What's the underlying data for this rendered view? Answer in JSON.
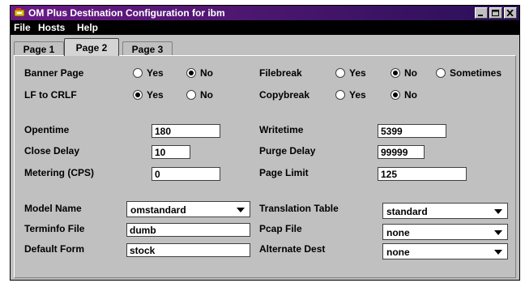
{
  "window": {
    "title": "OM Plus Destination Configuration for ibm"
  },
  "menu": {
    "file": "File",
    "hosts": "Hosts",
    "help": "Help"
  },
  "tabs": [
    {
      "label": "Page 1",
      "active": false
    },
    {
      "label": "Page 2",
      "active": true
    },
    {
      "label": "Page 3",
      "active": false
    }
  ],
  "options": {
    "banner_page": {
      "label": "Banner Page",
      "yes": "Yes",
      "no": "No",
      "selected": "No"
    },
    "filebreak": {
      "label": "Filebreak",
      "yes": "Yes",
      "no": "No",
      "sometimes": "Sometimes",
      "selected": "No"
    },
    "lf_to_crlf": {
      "label": "LF to CRLF",
      "yes": "Yes",
      "no": "No",
      "selected": "Yes"
    },
    "copybreak": {
      "label": "Copybreak",
      "yes": "Yes",
      "no": "No",
      "selected": "No"
    }
  },
  "timing": {
    "opentime": {
      "label": "Opentime",
      "value": "180"
    },
    "writetime": {
      "label": "Writetime",
      "value": "5399"
    },
    "close_delay": {
      "label": "Close Delay",
      "value": "10"
    },
    "purge_delay": {
      "label": "Purge Delay",
      "value": "99999"
    },
    "metering": {
      "label": "Metering (CPS)",
      "value": "0"
    },
    "page_limit": {
      "label": "Page Limit",
      "value": "125"
    }
  },
  "model": {
    "model_name": {
      "label": "Model Name",
      "value": "omstandard"
    },
    "translation_table": {
      "label": "Translation Table",
      "value": "standard"
    },
    "terminfo_file": {
      "label": "Terminfo File",
      "value": "dumb"
    },
    "pcap_file": {
      "label": "Pcap File",
      "value": "none"
    },
    "default_form": {
      "label": "Default Form",
      "value": "stock"
    },
    "alternate_dest": {
      "label": "Alternate Dest",
      "value": "none"
    }
  },
  "colors": {
    "titlebar": "#4d1770",
    "menubar": "#000000",
    "window_bg": "#c0c0c0"
  }
}
